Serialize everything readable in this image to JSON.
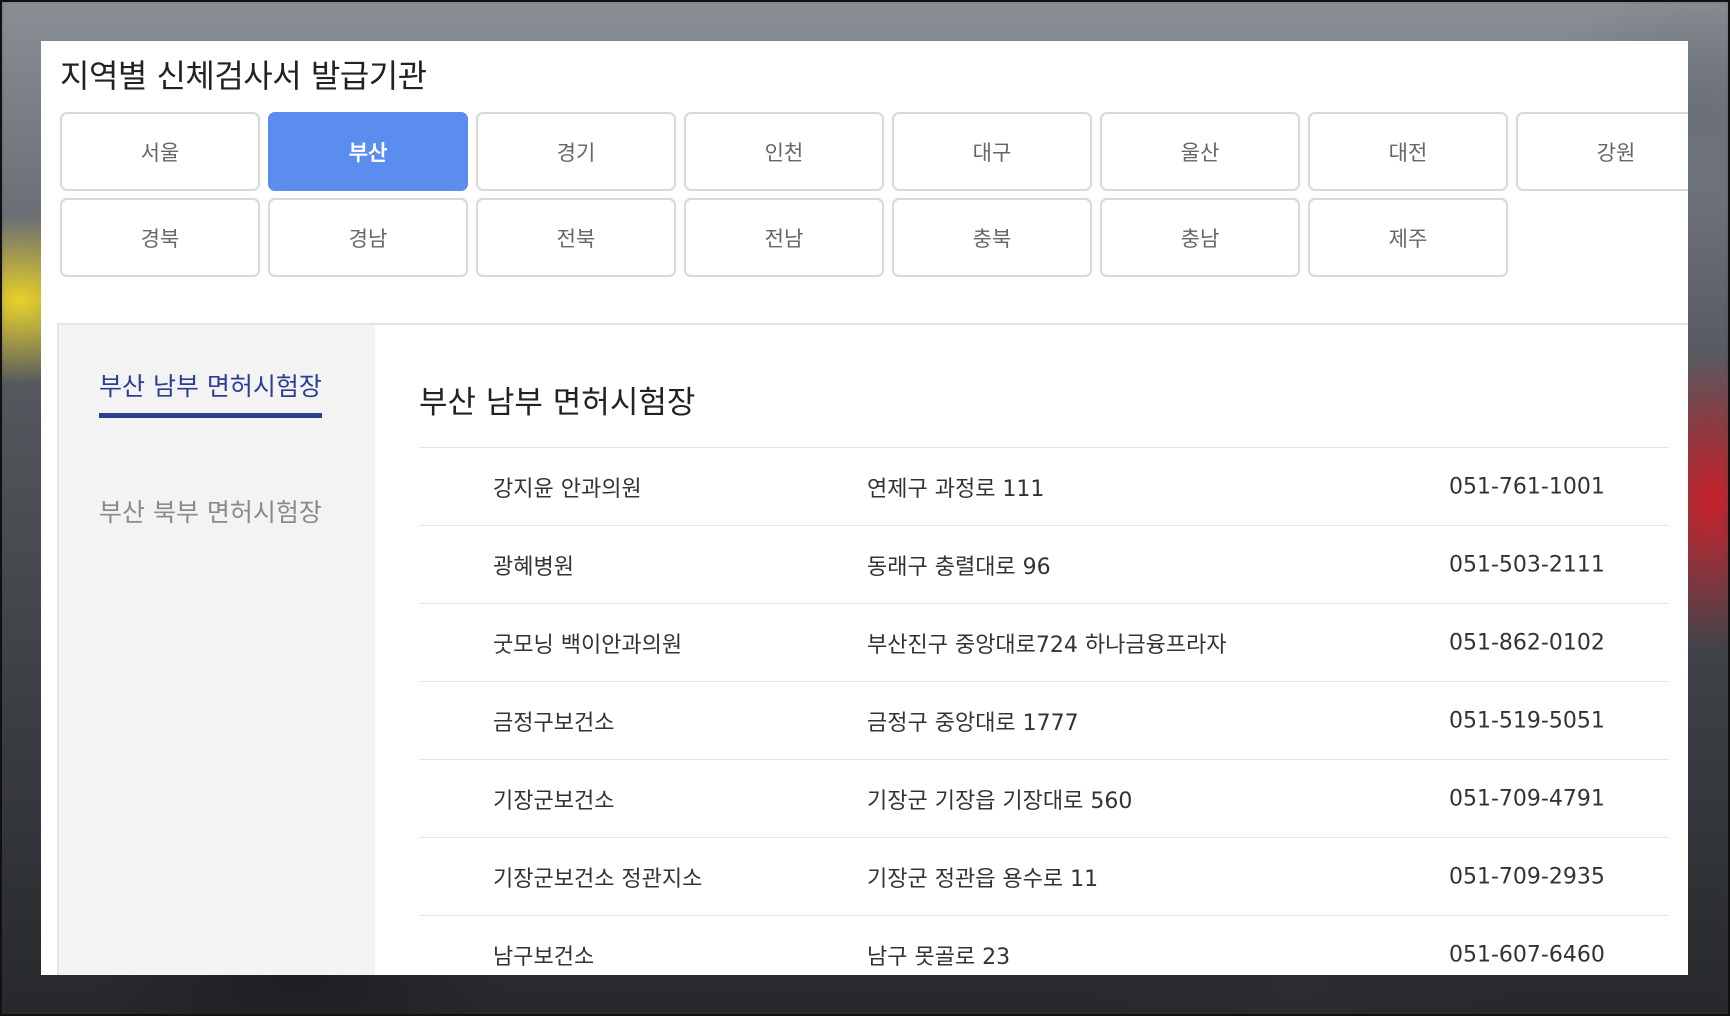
{
  "page": {
    "title": "지역별 신체검사서 발급기관"
  },
  "regions": {
    "row1": [
      {
        "label": "서울",
        "active": false
      },
      {
        "label": "부산",
        "active": true
      },
      {
        "label": "경기",
        "active": false
      },
      {
        "label": "인천",
        "active": false
      },
      {
        "label": "대구",
        "active": false
      },
      {
        "label": "울산",
        "active": false
      },
      {
        "label": "대전",
        "active": false
      },
      {
        "label": "강원",
        "active": false
      }
    ],
    "row2": [
      {
        "label": "경북",
        "active": false
      },
      {
        "label": "경남",
        "active": false
      },
      {
        "label": "전북",
        "active": false
      },
      {
        "label": "전남",
        "active": false
      },
      {
        "label": "충북",
        "active": false
      },
      {
        "label": "충남",
        "active": false
      },
      {
        "label": "제주",
        "active": false
      }
    ]
  },
  "side_nav": {
    "items": [
      {
        "label": "부산 남부 면허시험장",
        "active": true
      },
      {
        "label": "부산 북부 면허시험장",
        "active": false
      }
    ]
  },
  "center": {
    "title": "부산 남부 면허시험장",
    "rows": [
      {
        "name": "강지윤 안과의원",
        "address": "연제구 과정로 111",
        "phone": "051-761-1001"
      },
      {
        "name": "광혜병원",
        "address": "동래구 충렬대로 96",
        "phone": "051-503-2111"
      },
      {
        "name": "굿모닝 백이안과의원",
        "address": "부산진구 중앙대로724 하나금융프라자",
        "phone": "051-862-0102"
      },
      {
        "name": "금정구보건소",
        "address": "금정구 중앙대로 1777",
        "phone": "051-519-5051"
      },
      {
        "name": "기장군보건소",
        "address": "기장군 기장읍 기장대로 560",
        "phone": "051-709-4791"
      },
      {
        "name": "기장군보건소 정관지소",
        "address": "기장군 정관읍 용수로 11",
        "phone": "051-709-2935"
      },
      {
        "name": "남구보건소",
        "address": "남구 못골로 23",
        "phone": "051-607-6460"
      }
    ]
  },
  "colors": {
    "active_region": "#5b8def",
    "active_nav": "#2a3f8f",
    "sidebar_bg": "#f3f3f3"
  }
}
